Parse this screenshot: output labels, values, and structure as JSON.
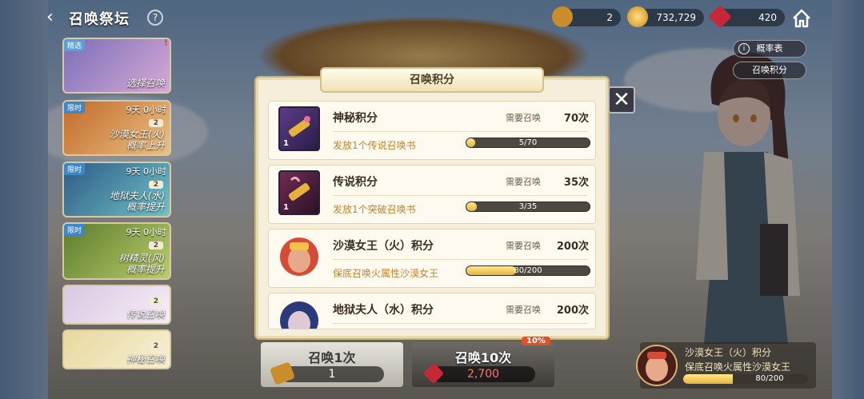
{
  "header": {
    "title": "召唤祭坛",
    "back_icon": "back-arrow-icon",
    "info_icon": "question-icon"
  },
  "resources": [
    {
      "icon": "summon-scroll-icon",
      "value": "2"
    },
    {
      "icon": "gold-coin-icon",
      "value": "732,729"
    },
    {
      "icon": "red-gem-icon",
      "value": "420"
    }
  ],
  "home_icon": "home-icon",
  "side_buttons": {
    "rates": "概率表",
    "points": "召唤积分"
  },
  "banners": [
    {
      "label": "选择召唤",
      "timer": "",
      "badge": "",
      "tag": "",
      "alert": "!"
    },
    {
      "label": "沙漠女王(火)\n概率上升",
      "timer": "9天 0小时",
      "badge": "2",
      "tag": "限时"
    },
    {
      "label": "地狱夫人(水)\n概率提升",
      "timer": "9天 0小时",
      "badge": "2",
      "tag": "限时"
    },
    {
      "label": "树精灵(风)\n概率提升",
      "timer": "9天 0小时",
      "badge": "2",
      "tag": "限时"
    },
    {
      "label": "传说召唤",
      "timer": "",
      "badge": "2",
      "tag": ""
    },
    {
      "label": "神秘召唤",
      "timer": "",
      "badge": "2",
      "tag": ""
    }
  ],
  "modal": {
    "title": "召唤积分",
    "close_icon": "close-icon",
    "need_label": "需要召唤",
    "cards": [
      {
        "name": "神秘积分",
        "times": "70次",
        "reward": "发放1个传说召唤书",
        "progress": "5/70",
        "fraction": 0.07,
        "icon_count": "1",
        "icon": "mystic-scroll-icon"
      },
      {
        "name": "传说积分",
        "times": "35次",
        "reward": "发放1个突破召唤书",
        "progress": "3/35",
        "fraction": 0.086,
        "icon_count": "1",
        "icon": "legend-scroll-icon"
      },
      {
        "name": "沙漠女王（火）积分",
        "times": "200次",
        "reward": "保底召唤火属性沙漠女王",
        "progress": "80/200",
        "fraction": 0.4,
        "icon": "desert-queen-portrait"
      },
      {
        "name": "地狱夫人（水）积分",
        "times": "200次",
        "reward": "",
        "progress": "",
        "icon": "hell-lady-portrait"
      }
    ]
  },
  "summon_buttons": {
    "single": {
      "title": "召唤1次",
      "cost": "1"
    },
    "ten": {
      "title": "召唤10次",
      "cost": "2,700",
      "discount": "10%"
    }
  },
  "tracker": {
    "name": "沙漠女王（火）积分",
    "reward": "保底召唤火属性沙漠女王",
    "progress": "80/200",
    "fraction": 0.4
  }
}
